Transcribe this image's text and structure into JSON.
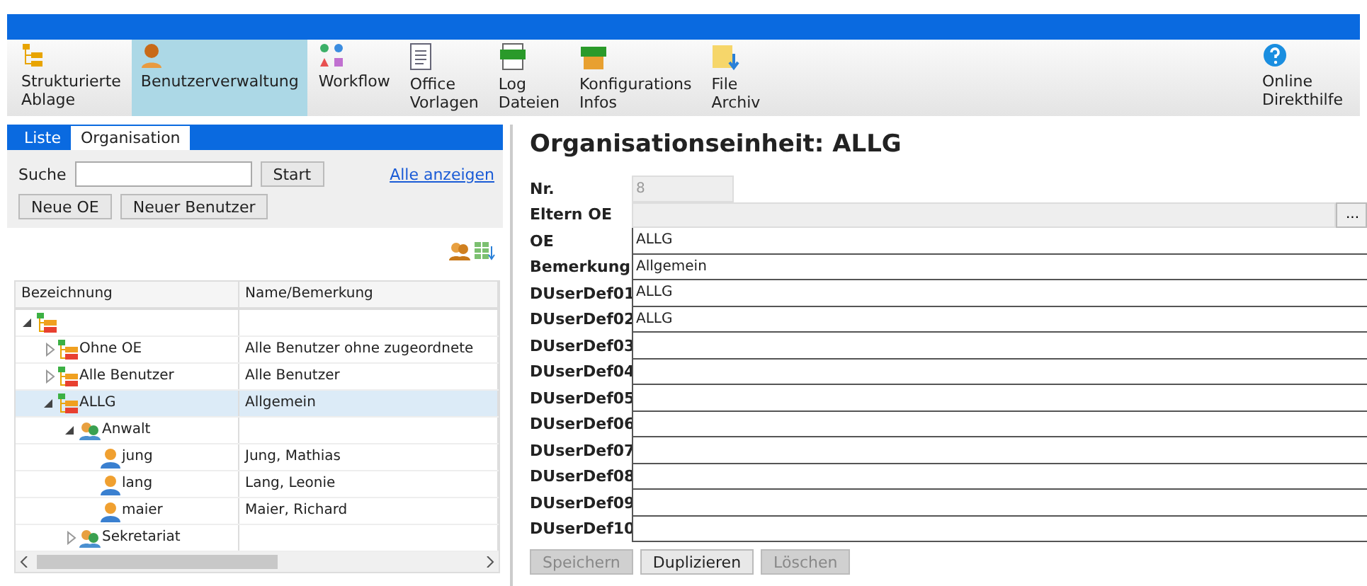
{
  "toolbar": [
    {
      "kind": "tree",
      "label": "Strukturierte Ablage",
      "selected": false
    },
    {
      "kind": "user",
      "label": "Benutzerverwaltung",
      "selected": true
    },
    {
      "kind": "workflow",
      "label": "Workflow",
      "selected": false
    },
    {
      "kind": "document",
      "label": "Office Vorlagen",
      "selected": false
    },
    {
      "kind": "log",
      "label": "Log Dateien",
      "selected": false
    },
    {
      "kind": "info",
      "label": "Konfigurations Infos",
      "selected": false
    },
    {
      "kind": "folder",
      "label": "File Archiv",
      "selected": false
    },
    {
      "kind": "help",
      "label": "Online Direkthilfe",
      "selected": false
    }
  ],
  "left_tabs": [
    {
      "label": "Liste",
      "selected": false
    },
    {
      "label": "Organisation",
      "selected": true
    }
  ],
  "search": {
    "label": "Suche",
    "button": "Start",
    "link": "Alle anzeigen"
  },
  "actions": [
    "Neue OE",
    "Neuer Benutzer"
  ],
  "tree": {
    "columns": [
      "Bezeichnung",
      "Name/Bemerkung"
    ],
    "rows": [
      {
        "kind": "org",
        "expanded": true,
        "selected": false,
        "children": [
          {
            "kind": "org",
            "name": "Ohne OE",
            "note": "Alle Benutzer ohne zugeordnete",
            "expanded": false,
            "selected": false
          },
          {
            "kind": "org",
            "name": "Alle Benutzer",
            "note": "Alle Benutzer",
            "expanded": false,
            "selected": false
          },
          {
            "kind": "org",
            "name": "ALLG",
            "note": "Allgemein",
            "expanded": true,
            "selected": true,
            "children": [
              {
                "kind": "group",
                "name": "Anwalt",
                "expanded": true,
                "selected": false,
                "children": [
                  {
                    "kind": "user",
                    "name": "jung",
                    "note": "Jung, Mathias",
                    "selected": false
                  },
                  {
                    "kind": "user",
                    "name": "lang",
                    "note": "Lang, Leonie",
                    "selected": false
                  },
                  {
                    "kind": "user",
                    "name": "maier",
                    "note": "Maier, Richard",
                    "selected": false
                  }
                ]
              },
              {
                "kind": "group",
                "name": "Sekretariat",
                "expanded": false,
                "selected": false
              }
            ]
          }
        ]
      }
    ]
  },
  "detail": {
    "title": "Organisationseinheit: ALLG",
    "fields": [
      {
        "label": "Nr.",
        "value": "8",
        "kind": "short",
        "disabled": true
      },
      {
        "label": "Eltern OE",
        "kind": "picker",
        "disabled": true,
        "button": "..."
      },
      {
        "label": "OE",
        "value": "ALLG",
        "kind": "text",
        "disabled": false
      },
      {
        "label": "Bemerkung",
        "value": "Allgemein",
        "kind": "text",
        "disabled": false
      },
      {
        "label": "DUserDef01",
        "value": "ALLG",
        "kind": "text",
        "disabled": false
      },
      {
        "label": "DUserDef02",
        "value": "ALLG",
        "kind": "text",
        "disabled": false
      },
      {
        "label": "DUserDef03",
        "kind": "text",
        "disabled": false
      },
      {
        "label": "DUserDef04",
        "kind": "text",
        "disabled": false
      },
      {
        "label": "DUserDef05",
        "kind": "text",
        "disabled": false
      },
      {
        "label": "DUserDef06",
        "kind": "text",
        "disabled": false
      },
      {
        "label": "DUserDef07",
        "kind": "text",
        "disabled": false
      },
      {
        "label": "DUserDef08",
        "kind": "text",
        "disabled": false
      },
      {
        "label": "DUserDef09",
        "kind": "text",
        "disabled": false
      },
      {
        "label": "DUserDef10",
        "kind": "text",
        "disabled": false
      }
    ],
    "buttons": [
      {
        "label": "Speichern",
        "disabled": true
      },
      {
        "label": "Duplizieren",
        "disabled": false
      },
      {
        "label": "Löschen",
        "disabled": true
      }
    ]
  }
}
